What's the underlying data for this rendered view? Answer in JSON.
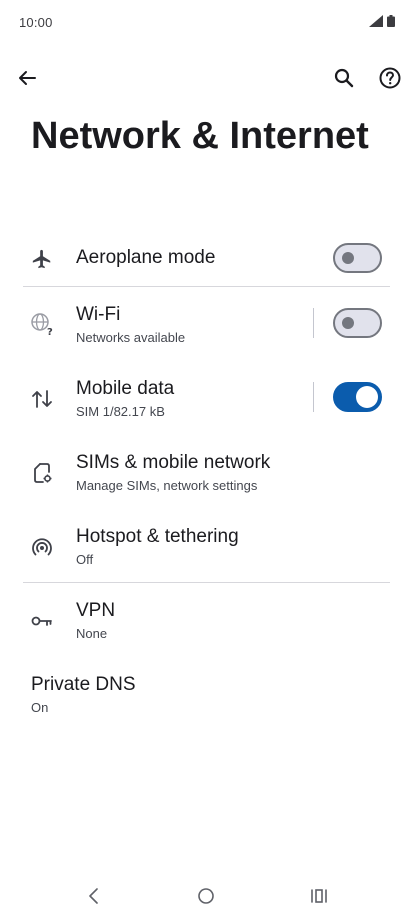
{
  "status_bar": {
    "time": "10:00",
    "icons": [
      "signal-icon",
      "battery-icon"
    ]
  },
  "top_bar": {
    "icons": [
      "back-arrow-icon",
      "search-icon",
      "help-icon"
    ]
  },
  "page": {
    "title": "Network & Internet"
  },
  "settings": {
    "aeroplane": {
      "title": "Aeroplane mode",
      "icon": "airplane-icon",
      "toggle_on": false
    },
    "wifi": {
      "title": "Wi-Fi",
      "subtitle": "Networks available",
      "icon": "wifi-globe-icon",
      "toggle_on": false
    },
    "mobile_data": {
      "title": "Mobile data",
      "subtitle": "SIM 1/82.17 kB",
      "icon": "data-arrows-icon",
      "toggle_on": true
    },
    "sims": {
      "title": "SIMs & mobile network",
      "subtitle": "Manage SIMs, network settings",
      "icon": "sim-card-icon"
    },
    "hotspot": {
      "title": "Hotspot & tethering",
      "subtitle": "Off",
      "icon": "hotspot-icon"
    },
    "vpn": {
      "title": "VPN",
      "subtitle": "None",
      "icon": "vpn-key-icon"
    },
    "private_dns": {
      "title": "Private DNS",
      "subtitle": "On"
    }
  },
  "nav_bar": {
    "icons": [
      "nav-back-icon",
      "nav-home-icon",
      "nav-recents-icon"
    ]
  },
  "colors": {
    "accent": "#0b5cad",
    "text_primary": "#1b1b1f",
    "text_secondary": "#44474f",
    "toggle_off_track": "#e1e2ec",
    "toggle_off_outline": "#74777f",
    "divider": "#d7d7dc"
  }
}
